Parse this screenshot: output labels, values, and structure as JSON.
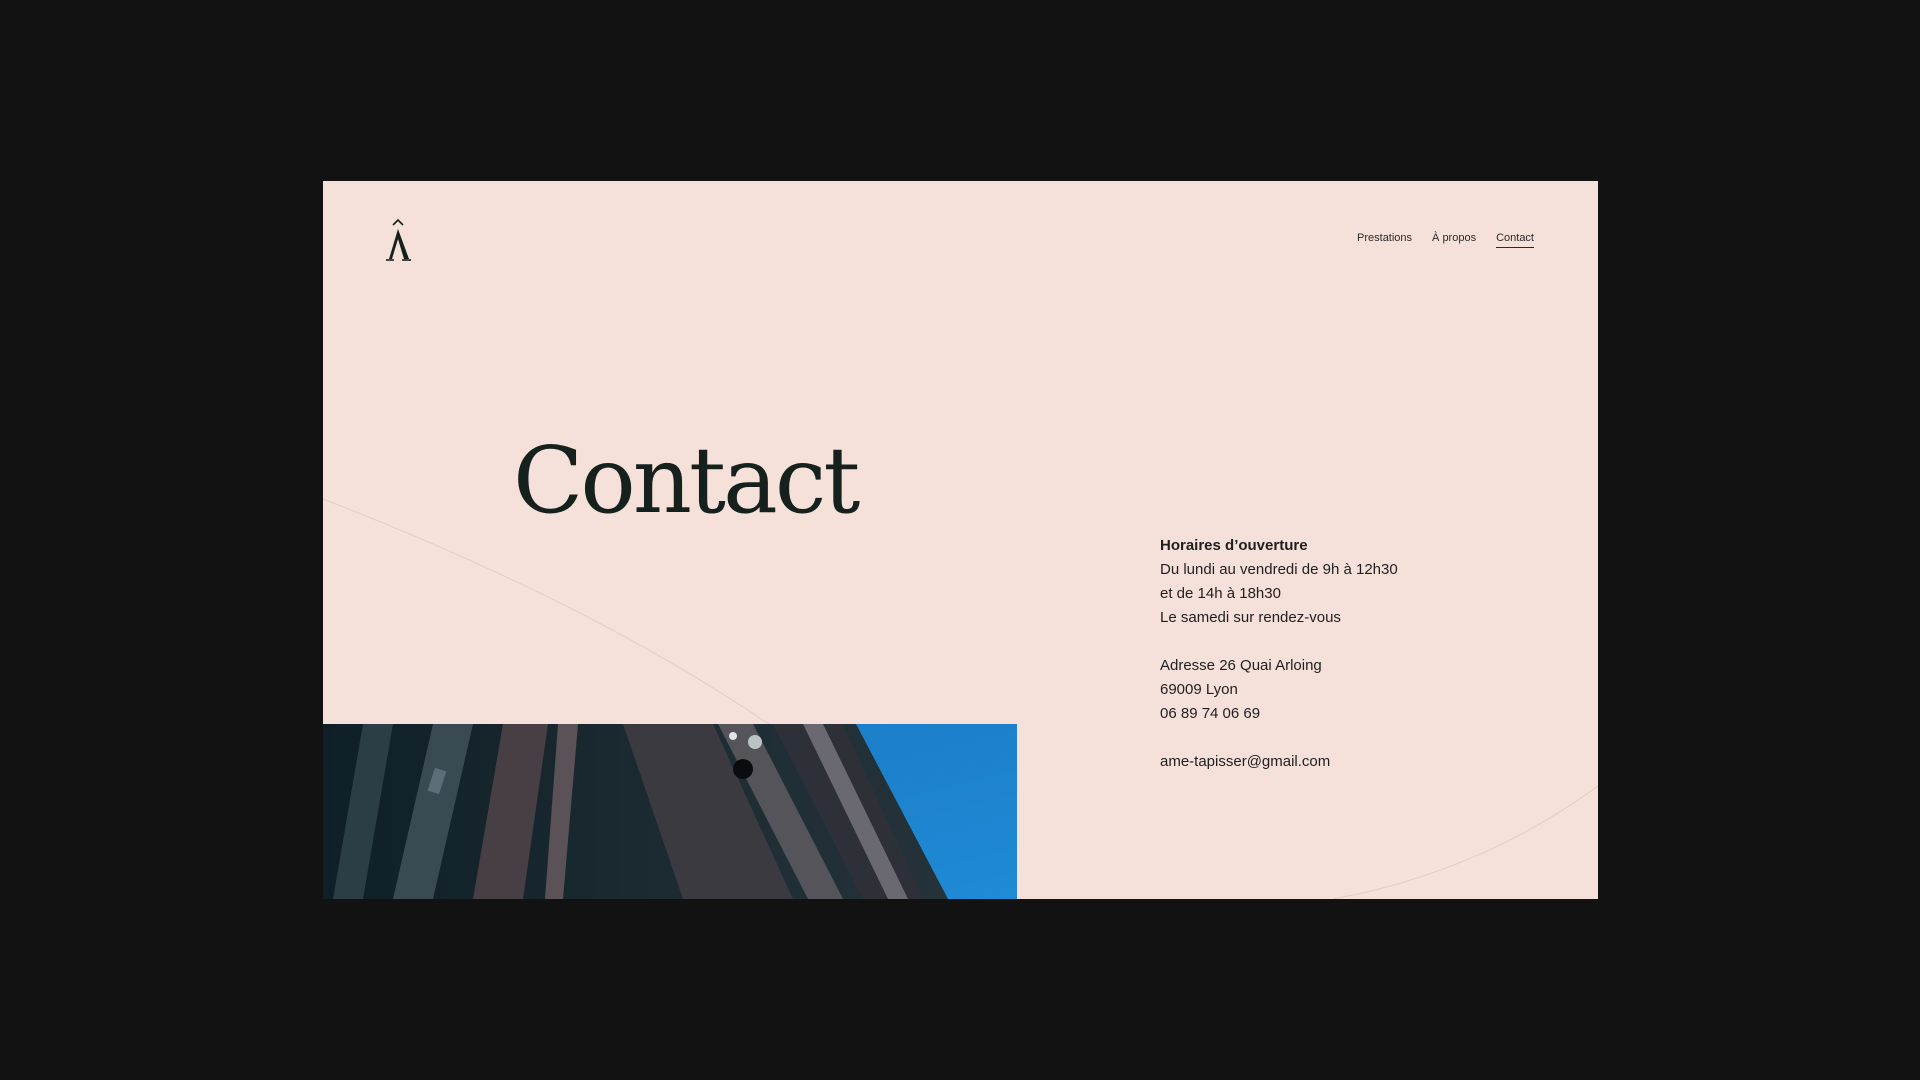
{
  "brand": {
    "logo_icon": "a-circumflex-logo-icon"
  },
  "nav": {
    "items": [
      {
        "label": "Prestations",
        "active": false
      },
      {
        "label": "À propos",
        "active": false
      },
      {
        "label": "Contact",
        "active": true
      }
    ]
  },
  "main": {
    "title": "Contact"
  },
  "contact": {
    "hours_title": "Horaires d’ouverture",
    "hours_line1": "Du lundi au vendredi de 9h à 12h30",
    "hours_line2": "et de 14h à 18h30",
    "hours_line3": "Le samedi sur rendez-vous",
    "address_line1": "Adresse 26 Quai Arloing",
    "address_line2": "69009 Lyon",
    "phone": "06 89 74 06 69",
    "email": "ame-tapisser@gmail.com"
  },
  "colors": {
    "page_background": "#f5e1d9",
    "outer_background": "#121212",
    "text_dark": "#16211d",
    "sky_blue": "#1d86cf"
  }
}
